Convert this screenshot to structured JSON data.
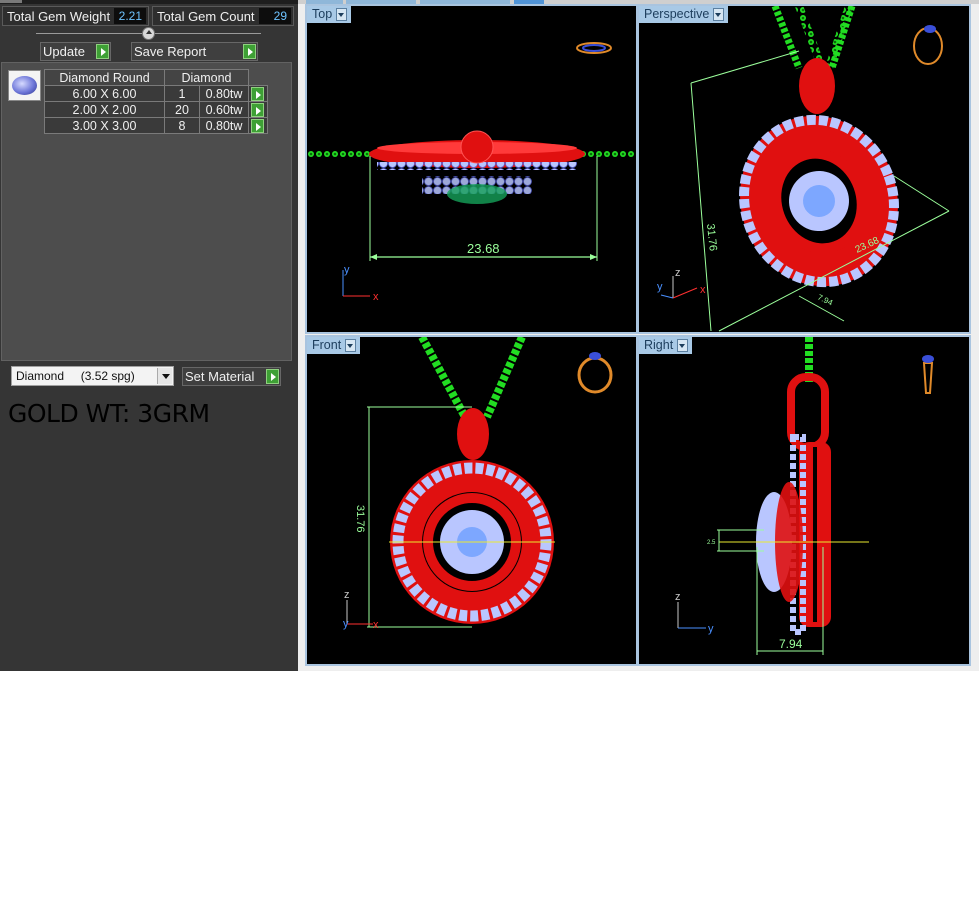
{
  "stats": {
    "total_gem_weight_label": "Total Gem Weight",
    "total_gem_weight": "2.21",
    "total_gem_count_label": "Total Gem Count",
    "total_gem_count": "29"
  },
  "actions": {
    "update_label": "Update",
    "save_report_label": "Save Report"
  },
  "gem_table": {
    "headers": [
      "Diamond Round",
      "Diamond"
    ],
    "rows": [
      {
        "size": "6.00 X 6.00",
        "count": "1",
        "weight": "0.80tw"
      },
      {
        "size": "2.00 X 2.00",
        "count": "20",
        "weight": "0.60tw"
      },
      {
        "size": "3.00 X 3.00",
        "count": "8",
        "weight": "0.80tw"
      }
    ]
  },
  "material": {
    "selected": "Diamond     (3.52 spg)",
    "set_material_label": "Set Material"
  },
  "note": "GOLD WT: 3GRM",
  "viewports": {
    "top": {
      "label": "Top",
      "dimension": "23.68"
    },
    "perspective": {
      "label": "Perspective",
      "dimension_height": "31.76",
      "dimension_width": "23.68",
      "dimension_depth": "7.94"
    },
    "front": {
      "label": "Front",
      "dimension": "31.76"
    },
    "right": {
      "label": "Right",
      "dimension": "7.94",
      "small_dimension": "2.5"
    }
  },
  "axes": {
    "x": "x",
    "y": "y",
    "z": "z"
  },
  "colors": {
    "metal": "#e01010",
    "chain": "#22dd22",
    "stones": "#b9c6ff",
    "dimension": "#9bff9b",
    "axis_x": "#ff3030",
    "axis_y": "#4a90ff",
    "axis_z": "#c8c8c8"
  },
  "icons": [
    "gem-thumbnail-icon",
    "ring-orientation-icon",
    "play-arrow-icon",
    "dropdown-arrow-icon"
  ]
}
